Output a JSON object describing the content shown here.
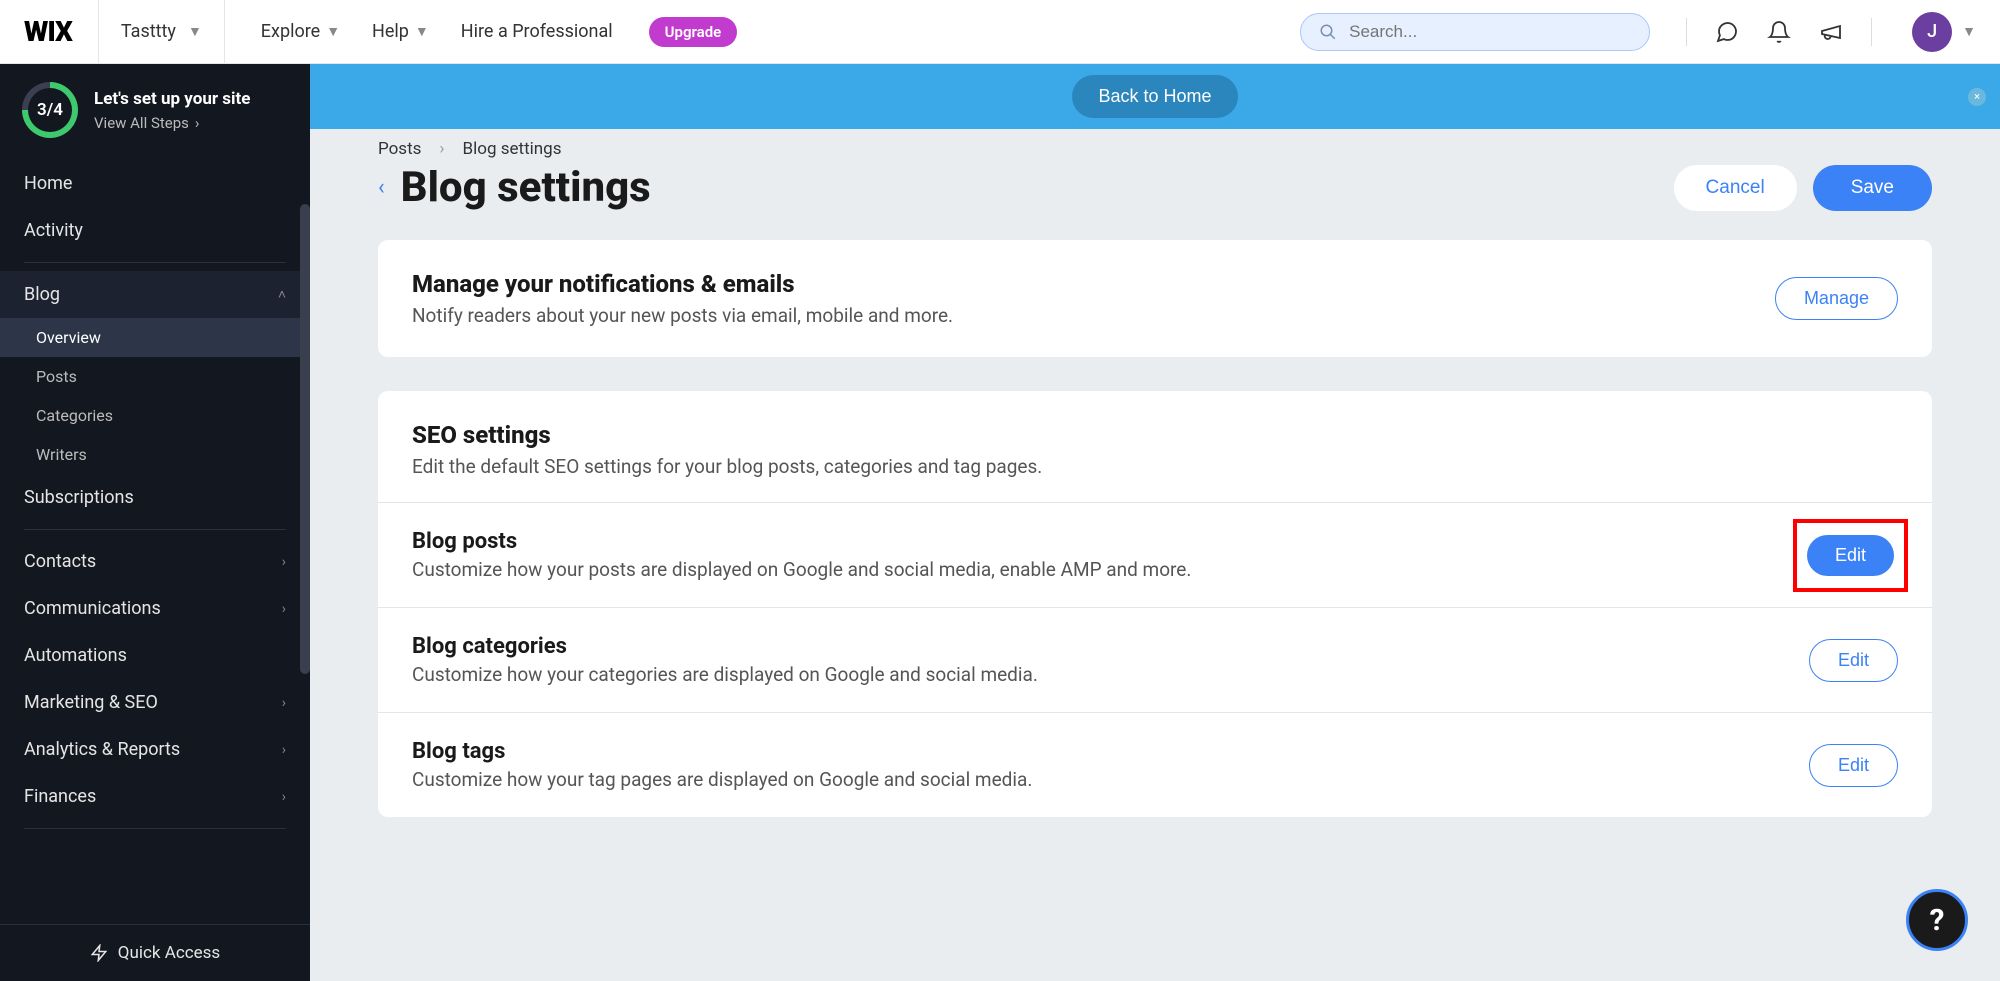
{
  "topbar": {
    "logo": "WIX",
    "site_name": "Tasttty",
    "nav": {
      "explore": "Explore",
      "help": "Help",
      "hire": "Hire a Professional"
    },
    "upgrade": "Upgrade",
    "search_placeholder": "Search...",
    "avatar_initial": "J"
  },
  "sidebar": {
    "setup": {
      "progress": "3/4",
      "title": "Let's set up your site",
      "link": "View All Steps"
    },
    "items": {
      "home": "Home",
      "activity": "Activity",
      "blog": "Blog",
      "subscriptions": "Subscriptions",
      "contacts": "Contacts",
      "communications": "Communications",
      "automations": "Automations",
      "marketing": "Marketing & SEO",
      "analytics": "Analytics & Reports",
      "finances": "Finances"
    },
    "blog_sub": {
      "overview": "Overview",
      "posts": "Posts",
      "categories": "Categories",
      "writers": "Writers"
    },
    "quick_access": "Quick Access"
  },
  "banner": {
    "button": "Back to Home",
    "close": "×"
  },
  "breadcrumb": {
    "posts": "Posts",
    "settings": "Blog settings"
  },
  "page": {
    "title": "Blog settings",
    "cancel": "Cancel",
    "save": "Save"
  },
  "notifications_card": {
    "title": "Manage your notifications & emails",
    "desc": "Notify readers about your new posts via email, mobile and more.",
    "button": "Manage"
  },
  "seo_card": {
    "title": "SEO settings",
    "desc": "Edit the default SEO settings for your blog posts, categories and tag pages.",
    "items": [
      {
        "title": "Blog posts",
        "desc": "Customize how your posts are displayed on Google and social media, enable AMP and more.",
        "button": "Edit"
      },
      {
        "title": "Blog categories",
        "desc": "Customize how your categories are displayed on Google and social media.",
        "button": "Edit"
      },
      {
        "title": "Blog tags",
        "desc": "Customize how your tag pages are displayed on Google and social media.",
        "button": "Edit"
      }
    ]
  },
  "help_fab": "?"
}
